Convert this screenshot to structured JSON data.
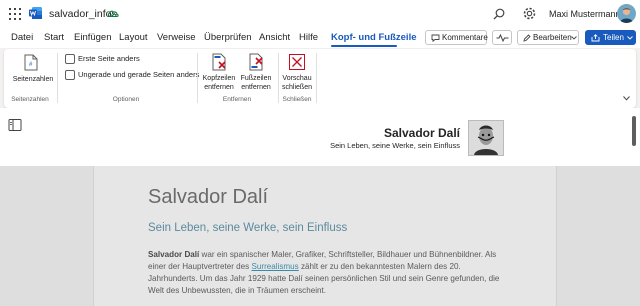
{
  "app": {
    "doc_title": "salvador_infos",
    "user_name": "Maxi Mustermann"
  },
  "tabs": [
    {
      "label": "Datei"
    },
    {
      "label": "Start"
    },
    {
      "label": "Einfügen"
    },
    {
      "label": "Layout"
    },
    {
      "label": "Verweise"
    },
    {
      "label": "Überprüfen"
    },
    {
      "label": "Ansicht"
    },
    {
      "label": "Hilfe"
    },
    {
      "label": "Kopf- und Fußzeile",
      "active": true
    }
  ],
  "toolbar": {
    "comments_label": "Kommentare",
    "edit_label": "Bearbeiten",
    "share_label": "Teilen"
  },
  "ribbon": {
    "page_numbers": "Seitenzahlen",
    "group_page_numbers": "Seitenzahlen",
    "first_page_different": "Erste Seite anders",
    "odd_even_different": "Ungerade und gerade Seiten anders",
    "group_options": "Optionen",
    "remove_header_1": "Kopfzeilen",
    "remove_header_2": "entfernen",
    "remove_footer_1": "Fußzeilen",
    "remove_footer_2": "entfernen",
    "group_remove": "Entfernen",
    "close_preview_1": "Vorschau",
    "close_preview_2": "schließen",
    "group_close": "Schließen"
  },
  "header": {
    "title": "Salvador Dalí",
    "subtitle": "Sein Leben, seine Werke, sein Einfluss"
  },
  "document": {
    "heading": "Salvador Dalí",
    "subheading": "Sein Leben, seine Werke, sein Einfluss",
    "body": {
      "name_bold": "Salvador Dalí",
      "text_1": " war ein spanischer Maler, Grafiker, Schriftsteller, Bildhauer und Bühnenbildner. Als einer der Hauptvertreter des ",
      "link": "Surrealismus",
      "text_2": " zählt er zu den bekanntesten Malern des 20. Jahrhunderts. Um das Jahr 1929 hatte Dalí seinen persönlichen Stil und sein Genre gefunden, die Welt des Unbewussten, die in Träumen erscheint."
    }
  },
  "colors": {
    "accent": "#185abd",
    "link": "#3b8aa8",
    "subheading": "#5b8a9e"
  }
}
